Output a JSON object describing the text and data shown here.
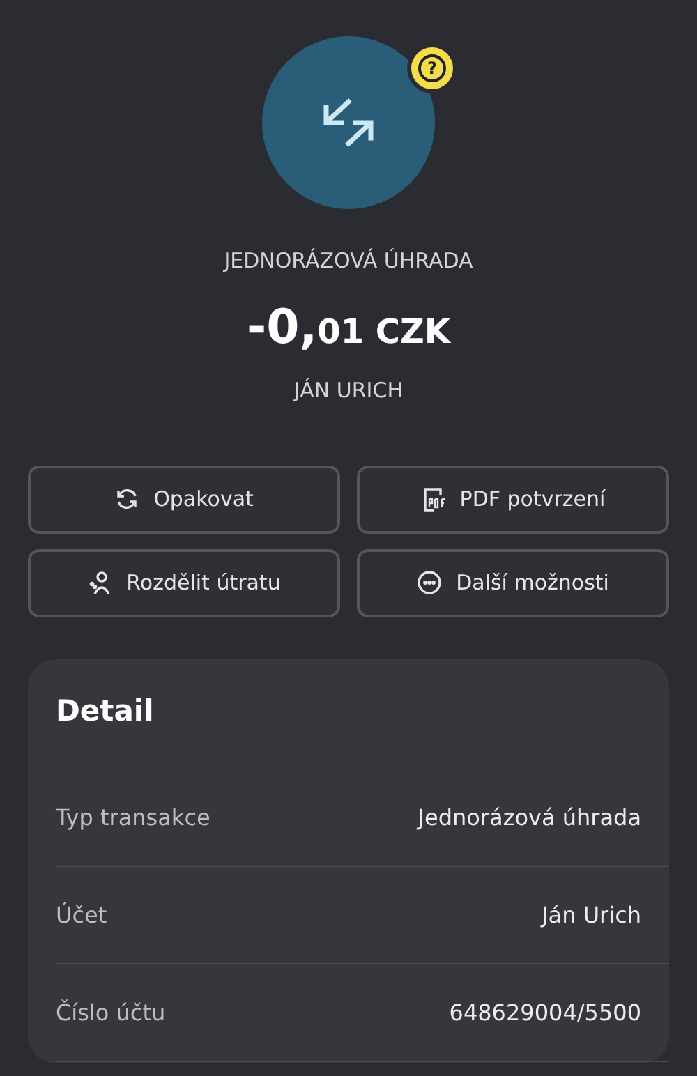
{
  "header": {
    "badge": "?",
    "type": "JEDNORÁZOVÁ ÚHRADA",
    "amount": {
      "whole": "-0,",
      "fraction": "01 CZK"
    },
    "counterparty": "JÁN URICH"
  },
  "actions": [
    {
      "kind": "repeat",
      "label": "Opakovat"
    },
    {
      "kind": "pdf",
      "label": "PDF potvrzení"
    },
    {
      "kind": "split",
      "label": "Rozdělit útratu"
    },
    {
      "kind": "more",
      "label": "Další možnosti"
    }
  ],
  "detail": {
    "title": "Detail",
    "rows": [
      {
        "label": "Typ transakce",
        "value": "Jednorázová úhrada"
      },
      {
        "label": "Účet",
        "value": "Ján Urich"
      },
      {
        "label": "Číslo účtu",
        "value": "648629004/5500"
      }
    ]
  }
}
